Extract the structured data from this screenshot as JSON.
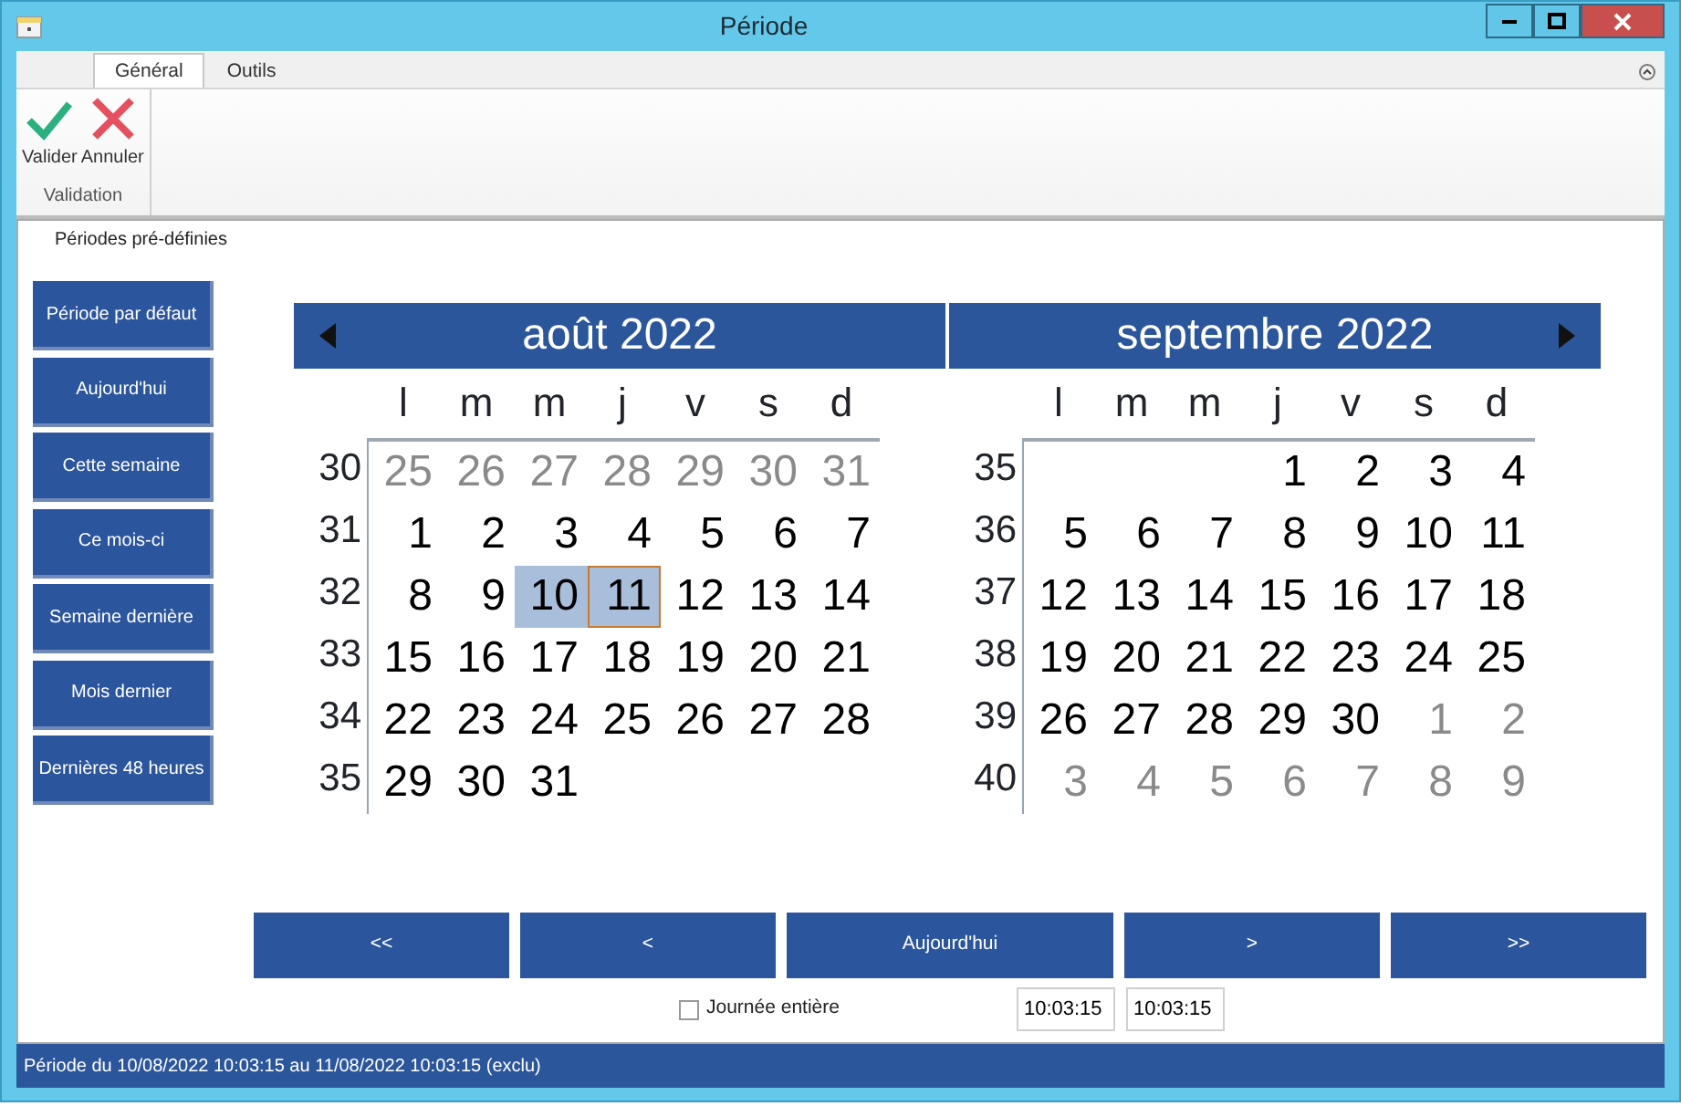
{
  "window": {
    "title": "Période"
  },
  "ribbon": {
    "tabs": [
      {
        "label": "Général",
        "selected": true
      },
      {
        "label": "Outils",
        "selected": false
      }
    ],
    "groups": [
      {
        "label": "Validation",
        "buttons": [
          {
            "kind": "ok",
            "label": "Valider"
          },
          {
            "kind": "cancel",
            "label": "Annuler"
          }
        ]
      }
    ]
  },
  "presets": {
    "title": "Périodes pré-définies",
    "buttons": [
      "Période par défaut",
      "Aujourd'hui",
      "Cette semaine",
      "Ce mois-ci",
      "Semaine dernière",
      "Mois dernier",
      "Dernières 48 heures"
    ]
  },
  "calendars": [
    {
      "title": "août 2022",
      "prev_arrow": true,
      "next_arrow": false,
      "weekdays": [
        "l",
        "m",
        "m",
        "j",
        "v",
        "s",
        "d"
      ],
      "weeks": [
        {
          "week": "30",
          "days": [
            {
              "text": "25",
              "other_month": true,
              "selected": false,
              "focused": false
            },
            {
              "text": "26",
              "other_month": true,
              "selected": false,
              "focused": false
            },
            {
              "text": "27",
              "other_month": true,
              "selected": false,
              "focused": false
            },
            {
              "text": "28",
              "other_month": true,
              "selected": false,
              "focused": false
            },
            {
              "text": "29",
              "other_month": true,
              "selected": false,
              "focused": false
            },
            {
              "text": "30",
              "other_month": true,
              "selected": false,
              "focused": false
            },
            {
              "text": "31",
              "other_month": true,
              "selected": false,
              "focused": false
            }
          ]
        },
        {
          "week": "31",
          "days": [
            {
              "text": "1",
              "other_month": false,
              "selected": false,
              "focused": false
            },
            {
              "text": "2",
              "other_month": false,
              "selected": false,
              "focused": false
            },
            {
              "text": "3",
              "other_month": false,
              "selected": false,
              "focused": false
            },
            {
              "text": "4",
              "other_month": false,
              "selected": false,
              "focused": false
            },
            {
              "text": "5",
              "other_month": false,
              "selected": false,
              "focused": false
            },
            {
              "text": "6",
              "other_month": false,
              "selected": false,
              "focused": false
            },
            {
              "text": "7",
              "other_month": false,
              "selected": false,
              "focused": false
            }
          ]
        },
        {
          "week": "32",
          "days": [
            {
              "text": "8",
              "other_month": false,
              "selected": false,
              "focused": false
            },
            {
              "text": "9",
              "other_month": false,
              "selected": false,
              "focused": false
            },
            {
              "text": "10",
              "other_month": false,
              "selected": true,
              "focused": false
            },
            {
              "text": "11",
              "other_month": false,
              "selected": true,
              "focused": true
            },
            {
              "text": "12",
              "other_month": false,
              "selected": false,
              "focused": false
            },
            {
              "text": "13",
              "other_month": false,
              "selected": false,
              "focused": false
            },
            {
              "text": "14",
              "other_month": false,
              "selected": false,
              "focused": false
            }
          ]
        },
        {
          "week": "33",
          "days": [
            {
              "text": "15",
              "other_month": false,
              "selected": false,
              "focused": false
            },
            {
              "text": "16",
              "other_month": false,
              "selected": false,
              "focused": false
            },
            {
              "text": "17",
              "other_month": false,
              "selected": false,
              "focused": false
            },
            {
              "text": "18",
              "other_month": false,
              "selected": false,
              "focused": false
            },
            {
              "text": "19",
              "other_month": false,
              "selected": false,
              "focused": false
            },
            {
              "text": "20",
              "other_month": false,
              "selected": false,
              "focused": false
            },
            {
              "text": "21",
              "other_month": false,
              "selected": false,
              "focused": false
            }
          ]
        },
        {
          "week": "34",
          "days": [
            {
              "text": "22",
              "other_month": false,
              "selected": false,
              "focused": false
            },
            {
              "text": "23",
              "other_month": false,
              "selected": false,
              "focused": false
            },
            {
              "text": "24",
              "other_month": false,
              "selected": false,
              "focused": false
            },
            {
              "text": "25",
              "other_month": false,
              "selected": false,
              "focused": false
            },
            {
              "text": "26",
              "other_month": false,
              "selected": false,
              "focused": false
            },
            {
              "text": "27",
              "other_month": false,
              "selected": false,
              "focused": false
            },
            {
              "text": "28",
              "other_month": false,
              "selected": false,
              "focused": false
            }
          ]
        },
        {
          "week": "35",
          "right_aligned": false,
          "days": [
            {
              "text": "29",
              "other_month": false,
              "selected": false,
              "focused": false
            },
            {
              "text": "30",
              "other_month": false,
              "selected": false,
              "focused": false
            },
            {
              "text": "31",
              "other_month": false,
              "selected": false,
              "focused": false
            }
          ]
        }
      ]
    },
    {
      "title": "septembre 2022",
      "prev_arrow": false,
      "next_arrow": true,
      "weekdays": [
        "l",
        "m",
        "m",
        "j",
        "v",
        "s",
        "d"
      ],
      "weeks": [
        {
          "week": "35",
          "right_aligned": true,
          "days": [
            {
              "text": "1",
              "other_month": false,
              "selected": false,
              "focused": false
            },
            {
              "text": "2",
              "other_month": false,
              "selected": false,
              "focused": false
            },
            {
              "text": "3",
              "other_month": false,
              "selected": false,
              "focused": false
            },
            {
              "text": "4",
              "other_month": false,
              "selected": false,
              "focused": false
            }
          ]
        },
        {
          "week": "36",
          "days": [
            {
              "text": "5",
              "other_month": false,
              "selected": false,
              "focused": false
            },
            {
              "text": "6",
              "other_month": false,
              "selected": false,
              "focused": false
            },
            {
              "text": "7",
              "other_month": false,
              "selected": false,
              "focused": false
            },
            {
              "text": "8",
              "other_month": false,
              "selected": false,
              "focused": false
            },
            {
              "text": "9",
              "other_month": false,
              "selected": false,
              "focused": false
            },
            {
              "text": "10",
              "other_month": false,
              "selected": false,
              "focused": false
            },
            {
              "text": "11",
              "other_month": false,
              "selected": false,
              "focused": false
            }
          ]
        },
        {
          "week": "37",
          "days": [
            {
              "text": "12",
              "other_month": false,
              "selected": false,
              "focused": false
            },
            {
              "text": "13",
              "other_month": false,
              "selected": false,
              "focused": false
            },
            {
              "text": "14",
              "other_month": false,
              "selected": false,
              "focused": false
            },
            {
              "text": "15",
              "other_month": false,
              "selected": false,
              "focused": false
            },
            {
              "text": "16",
              "other_month": false,
              "selected": false,
              "focused": false
            },
            {
              "text": "17",
              "other_month": false,
              "selected": false,
              "focused": false
            },
            {
              "text": "18",
              "other_month": false,
              "selected": false,
              "focused": false
            }
          ]
        },
        {
          "week": "38",
          "days": [
            {
              "text": "19",
              "other_month": false,
              "selected": false,
              "focused": false
            },
            {
              "text": "20",
              "other_month": false,
              "selected": false,
              "focused": false
            },
            {
              "text": "21",
              "other_month": false,
              "selected": false,
              "focused": false
            },
            {
              "text": "22",
              "other_month": false,
              "selected": false,
              "focused": false
            },
            {
              "text": "23",
              "other_month": false,
              "selected": false,
              "focused": false
            },
            {
              "text": "24",
              "other_month": false,
              "selected": false,
              "focused": false
            },
            {
              "text": "25",
              "other_month": false,
              "selected": false,
              "focused": false
            }
          ]
        },
        {
          "week": "39",
          "days": [
            {
              "text": "26",
              "other_month": false,
              "selected": false,
              "focused": false
            },
            {
              "text": "27",
              "other_month": false,
              "selected": false,
              "focused": false
            },
            {
              "text": "28",
              "other_month": false,
              "selected": false,
              "focused": false
            },
            {
              "text": "29",
              "other_month": false,
              "selected": false,
              "focused": false
            },
            {
              "text": "30",
              "other_month": false,
              "selected": false,
              "focused": false
            },
            {
              "text": "1",
              "other_month": true,
              "selected": false,
              "focused": false
            },
            {
              "text": "2",
              "other_month": true,
              "selected": false,
              "focused": false
            }
          ]
        },
        {
          "week": "40",
          "days": [
            {
              "text": "3",
              "other_month": true,
              "selected": false,
              "focused": false
            },
            {
              "text": "4",
              "other_month": true,
              "selected": false,
              "focused": false
            },
            {
              "text": "5",
              "other_month": true,
              "selected": false,
              "focused": false
            },
            {
              "text": "6",
              "other_month": true,
              "selected": false,
              "focused": false
            },
            {
              "text": "7",
              "other_month": true,
              "selected": false,
              "focused": false
            },
            {
              "text": "8",
              "other_month": true,
              "selected": false,
              "focused": false
            },
            {
              "text": "9",
              "other_month": true,
              "selected": false,
              "focused": false
            }
          ]
        }
      ]
    }
  ],
  "navigation": [
    {
      "label": "<<",
      "kind": "small"
    },
    {
      "label": "<",
      "kind": "small"
    },
    {
      "label": "Aujourd'hui",
      "kind": "wide"
    },
    {
      "label": ">",
      "kind": "small"
    },
    {
      "label": ">>",
      "kind": "small"
    }
  ],
  "whole_day": {
    "label": "Journée entière",
    "checked": false
  },
  "times": [
    "10:03:15",
    "10:03:15"
  ],
  "status_bar": "Période du 10/08/2022 10:03:15 au 11/08/2022 10:03:15 (exclu)"
}
